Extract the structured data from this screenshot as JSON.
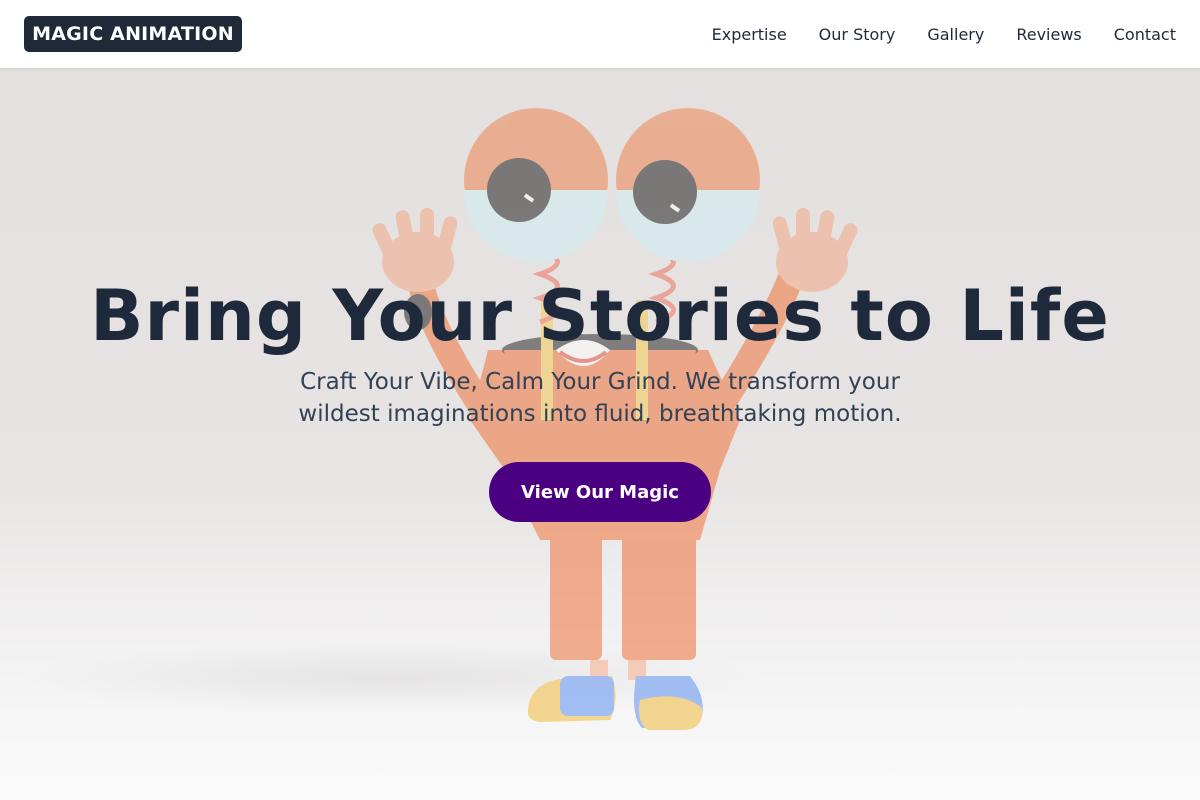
{
  "brand": {
    "name": "MAGIC ANIMATION"
  },
  "nav": {
    "items": [
      {
        "label": "Expertise"
      },
      {
        "label": "Our Story"
      },
      {
        "label": "Gallery"
      },
      {
        "label": "Reviews"
      },
      {
        "label": "Contact"
      }
    ]
  },
  "hero": {
    "title": "Bring Your Stories to Life",
    "subtitle": "Craft Your Vibe, Calm Your Grind. We transform your wildest imaginations into fluid, breathtaking motion.",
    "cta_label": "View Our Magic",
    "illustration": "cartoon-character-with-spring-eyes"
  },
  "colors": {
    "brand_bg": "#1f2937",
    "cta_bg": "#4b0082",
    "title_text": "#1e293b"
  }
}
